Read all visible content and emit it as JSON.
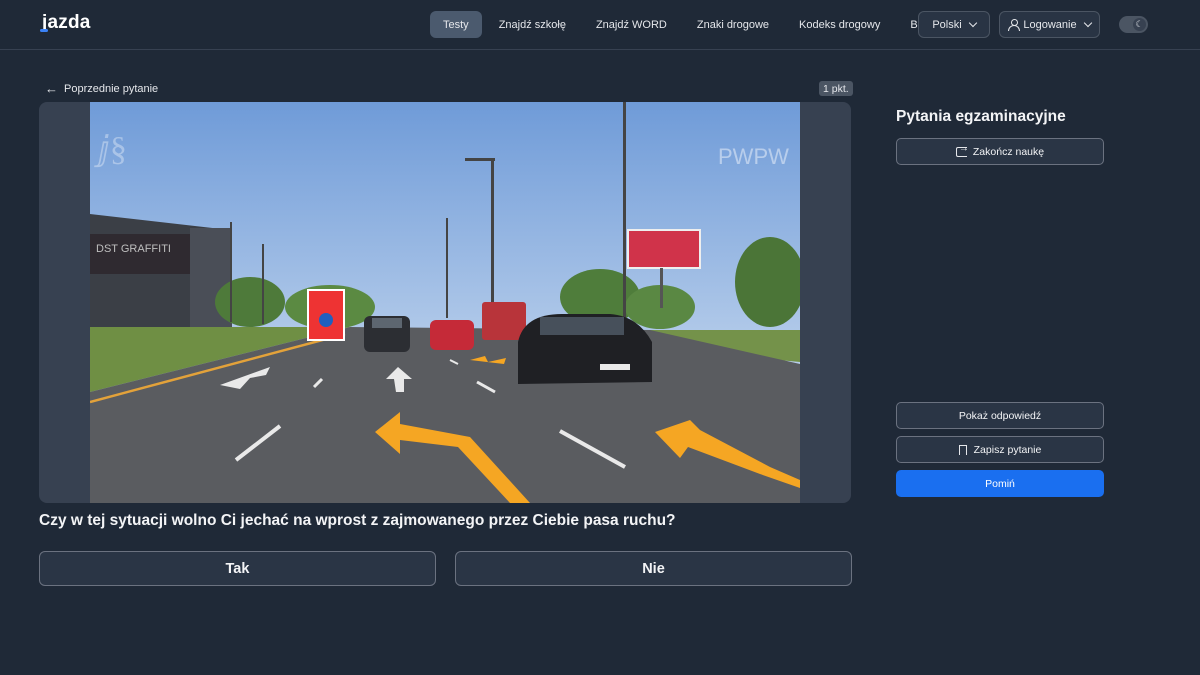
{
  "header": {
    "logo": "jazda",
    "nav": [
      {
        "label": "Testy",
        "active": true
      },
      {
        "label": "Znajdź szkołę",
        "active": false
      },
      {
        "label": "Znajdź WORD",
        "active": false
      },
      {
        "label": "Znaki drogowe",
        "active": false
      },
      {
        "label": "Kodeks drogowy",
        "active": false
      },
      {
        "label": "Blog",
        "active": false
      }
    ],
    "language": "Polski",
    "login": "Logowanie",
    "theme_icon": "moon-icon"
  },
  "question": {
    "prev_label": "Poprzednie pytanie",
    "points": "1 pkt.",
    "text": "Czy w tej sytuacji wolno Ci jechać na wprost z zajmowanego przez Ciebie pasa ruchu?",
    "answers": [
      "Tak",
      "Nie"
    ],
    "watermark": "PWPW"
  },
  "sidebar": {
    "title": "Pytania egzaminacyjne",
    "end_label": "Zakończ naukę",
    "show_label": "Pokaż odpowiedź",
    "save_label": "Zapisz pytanie",
    "skip_label": "Pomiń"
  },
  "colors": {
    "background": "#1f2937",
    "accent": "#1a6ff0",
    "road_arrow": "#f5a623"
  }
}
